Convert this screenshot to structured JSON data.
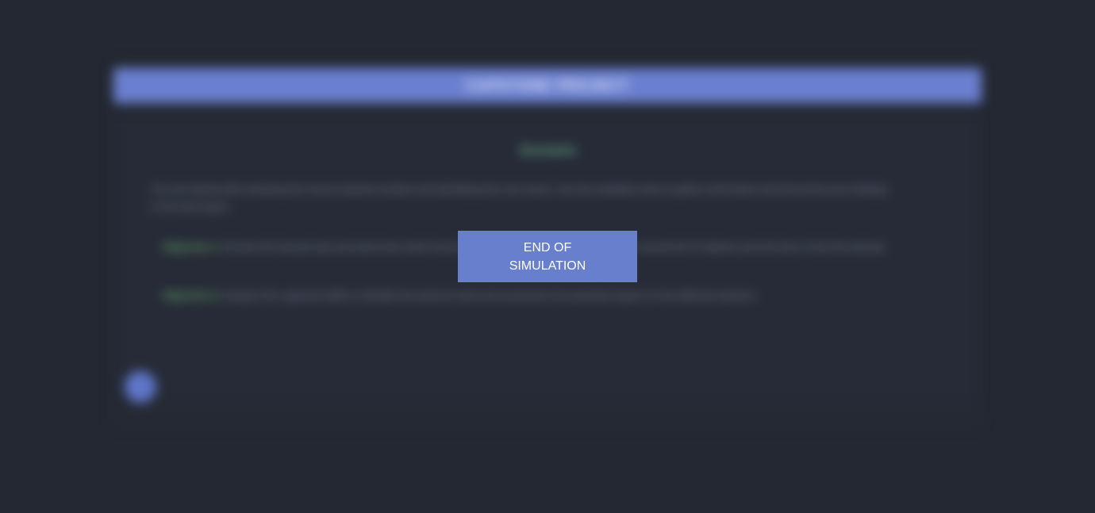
{
  "simulation": {
    "header_title": "CAPSTONE PROJECT",
    "subtitle": "Scenario",
    "intro": "You are tasked with reviewing the recent network incident and identifying the root cause. Use the available tools to gather information and document your findings in the final report.",
    "items": [
      {
        "label": "Objective 1:",
        "text": "Review the firewall logs and determine which host initiated the suspicious connection, then record the IP address and the time of the first attempt."
      },
      {
        "label": "Objective 2:",
        "text": "Analyze the captured traffic to identify the protocol used and summarize the potential impact on the affected systems."
      }
    ]
  },
  "end_button": {
    "label": "END OF SIMULATION"
  }
}
